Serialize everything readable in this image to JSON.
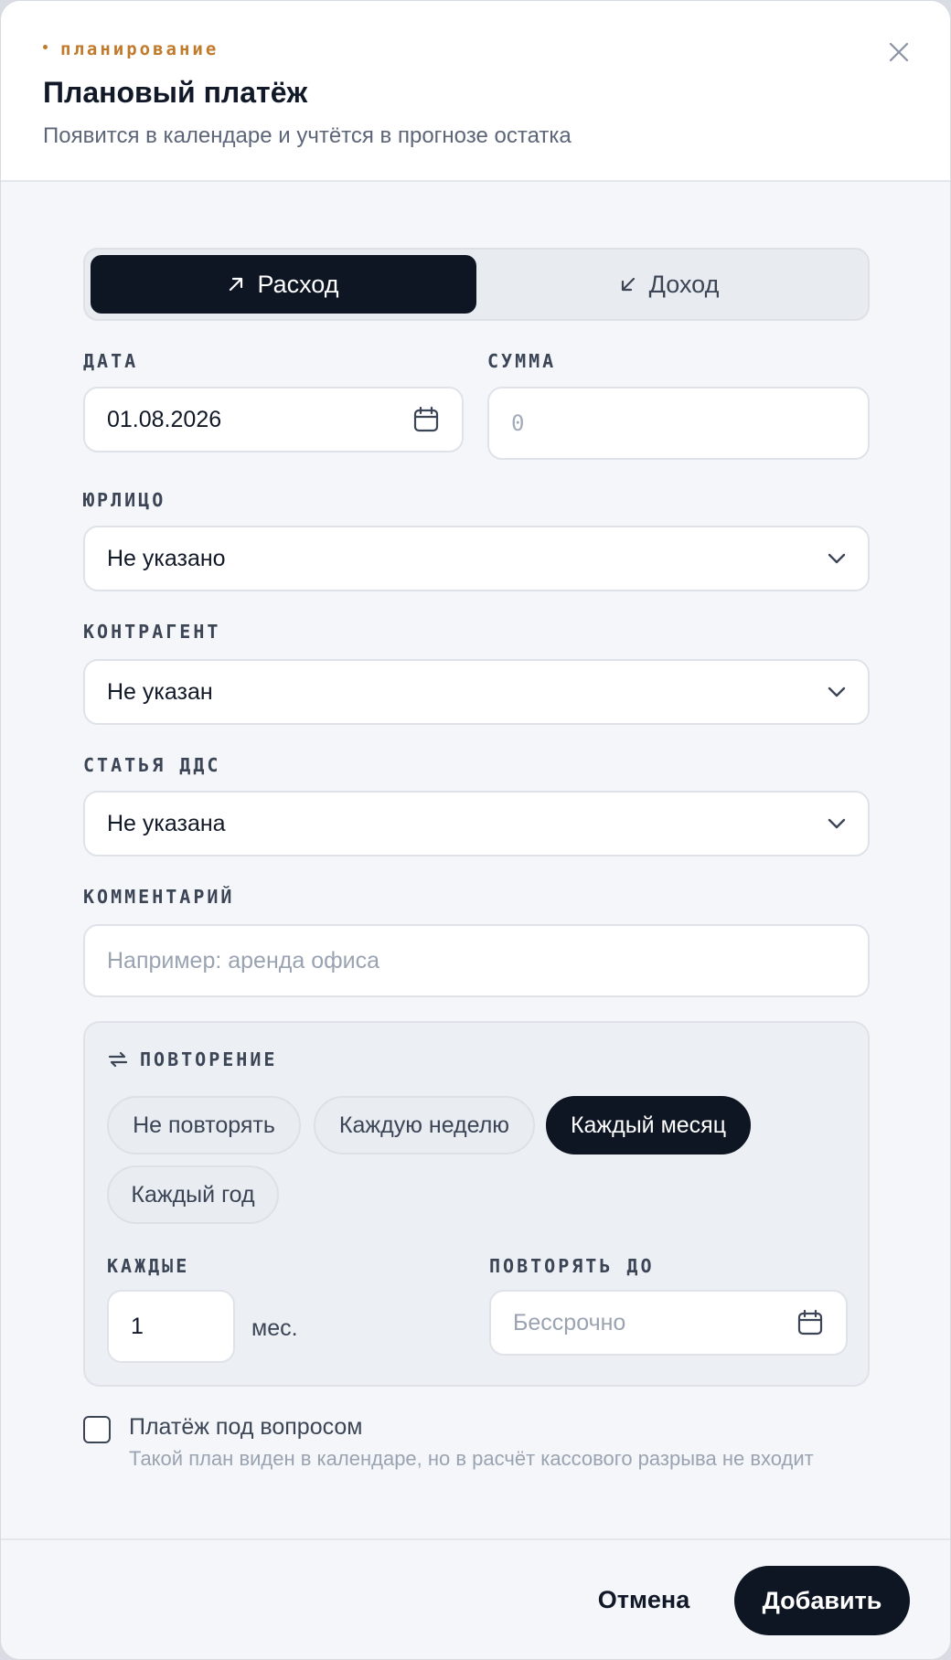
{
  "header": {
    "eyebrow": "планирование",
    "title": "Плановый платёж",
    "subtitle": "Появится в календаре и учтётся в прогнозе остатка",
    "close_icon": "close-icon"
  },
  "type_toggle": {
    "expense_label": "Расход",
    "income_label": "Доход",
    "selected": "expense"
  },
  "date": {
    "label": "ДАТА",
    "value": "01.08.2026"
  },
  "amount": {
    "label": "СУММА",
    "placeholder": "0"
  },
  "entity": {
    "label": "ЮРЛИЦО",
    "value": "Не указано"
  },
  "counterparty": {
    "label": "КОНТРАГЕНТ",
    "value": "Не указан"
  },
  "cashflow_item": {
    "label": "СТАТЬЯ ДДС",
    "value": "Не указана"
  },
  "comment": {
    "label": "КОММЕНТАРИЙ",
    "placeholder": "Например: аренда офиса"
  },
  "repeat": {
    "title": "ПОВТОРЕНИЕ",
    "options": [
      "Не повторять",
      "Каждую неделю",
      "Каждый месяц",
      "Каждый год"
    ],
    "selected": "Каждый месяц",
    "every_label": "КАЖДЫЕ",
    "every_value": "1",
    "every_unit": "мес.",
    "until_label": "ПОВТОРЯТЬ ДО",
    "until_placeholder": "Бессрочно"
  },
  "questionable": {
    "checked": false,
    "title": "Платёж под вопросом",
    "hint": "Такой план виден в календаре, но в расчёт кассового разрыва не входит"
  },
  "footer": {
    "cancel_label": "Отмена",
    "submit_label": "Добавить"
  },
  "colors": {
    "accent": "#c07a2a",
    "primary_dark": "#0e1523",
    "background": "#f4f6f9"
  }
}
